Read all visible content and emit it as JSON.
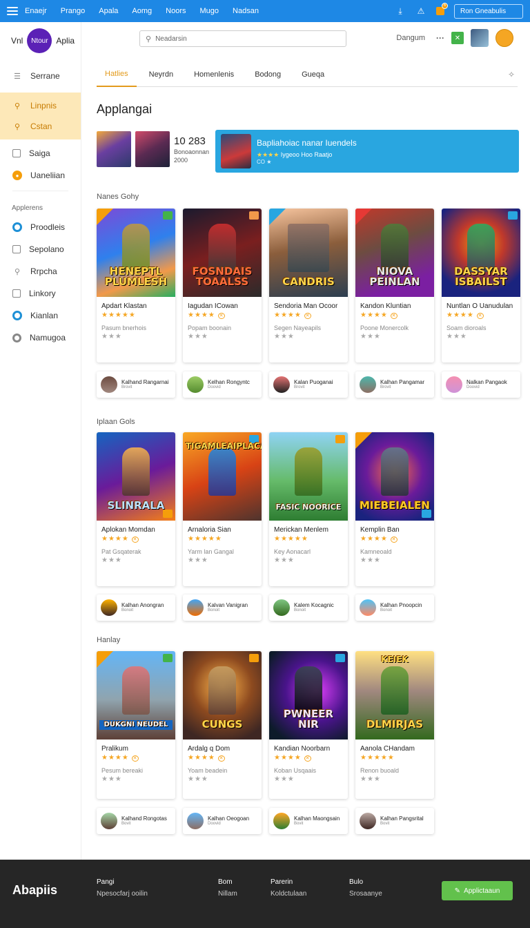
{
  "topbar": {
    "nav": [
      "Enaejr",
      "Prango",
      "Apala",
      "Aomg",
      "Noors",
      "Mugo",
      "Nadsan"
    ],
    "button_label": "Ron Gneabulis",
    "notif_count": "6"
  },
  "sidebar": {
    "brand_left": "Vnl",
    "logo_text": "Ntour",
    "brand_right": "Aplia",
    "menu_label": "Serrane",
    "active_items": [
      "Linpnis",
      "Cstan"
    ],
    "items": [
      "Saiga",
      "Uaneliian"
    ],
    "section_heading": "Applerens",
    "section_items": [
      "Proodleis",
      "Sepolano",
      "Rrpcha",
      "Linkory",
      "Kianlan",
      "Namugoa"
    ]
  },
  "header": {
    "search_placeholder": "Neadarsin",
    "right_label": "Dangum"
  },
  "tabs": [
    "Hatlies",
    "Neyrdn",
    "Homenlenis",
    "Bodong",
    "Gueqa"
  ],
  "page_title": "Applangai",
  "featured": {
    "count": "10 283",
    "sub1": "Bonoaonnan",
    "sub2": "2000",
    "banner_title": "Bapliahoiac nanar Iuendels",
    "banner_stars": "★★★★",
    "banner_sub": "Iygeoo Hoo Raatjo",
    "banner_sub2": "CO ★"
  },
  "sections": [
    {
      "title": "Nanes Gohy",
      "cards": [
        {
          "art": "HENEPTL PLUMLESH",
          "title": "Apdart Klastan",
          "desc": "Pasum bnerhois"
        },
        {
          "art": "FOSNDAIS TOAALSS",
          "title": "Iagudan ICowan",
          "desc": "Popam boonain"
        },
        {
          "art": "CANDRIS",
          "title": "Sendoria Man Ocoor",
          "desc": "Segen Nayeapils"
        },
        {
          "art": "NIOVA PEINLAN",
          "title": "Kandon Kluntian",
          "desc": "Poone Monercolk"
        },
        {
          "art": "DASSYAR ISBAILST",
          "title": "Nuntlan O Uanudulan",
          "desc": "Soam dioroals"
        }
      ],
      "pills": [
        {
          "title": "Kalhand Rangarnai",
          "sub": "Brovit"
        },
        {
          "title": "Kelhan Rongyntc",
          "sub": "Doovid"
        },
        {
          "title": "Kalan Puoganai",
          "sub": "Brovit"
        },
        {
          "title": "Kalhan Pangamar",
          "sub": "Brovit"
        },
        {
          "title": "Nalkan Pangaok",
          "sub": "Doovid"
        }
      ]
    },
    {
      "title": "Iplaan Gols",
      "cards": [
        {
          "art": "SLINRALA",
          "title": "Aplokan Momdan",
          "desc": "Pat Gsqaterak"
        },
        {
          "art": "TIGAMLEAIPLACA",
          "title": "Arnaloria Sian",
          "desc": "Yarm lan Gangal"
        },
        {
          "art": "FASIC NOORICE",
          "title": "Merickan Menlem",
          "desc": "Key Aonacarl"
        },
        {
          "art": "MIEBEIALEN",
          "title": "Kemplin Ban",
          "desc": "Kamneoald"
        }
      ],
      "pills": [
        {
          "title": "Kalhan Anongran",
          "sub": "Bonoit"
        },
        {
          "title": "Kalvan Vanigran",
          "sub": "Bonoit"
        },
        {
          "title": "Kalem Kocagnic",
          "sub": "Bonoit"
        },
        {
          "title": "Kalhan Pnoopcin",
          "sub": "Bonoit"
        }
      ]
    },
    {
      "title": "Hanlay",
      "cards": [
        {
          "art": "DUKGNI NEUDEL",
          "title": "Pralikum",
          "desc": "Pesum bereaki"
        },
        {
          "art": "CUNGS",
          "title": "Ardalg q Dom",
          "desc": "Yoam beadein"
        },
        {
          "art": "PWNEER NIR",
          "title": "Kandian Noorbarn",
          "desc": "Koban Usqaais"
        },
        {
          "art": "DLMIRJAS",
          "title": "Aanola CHandam",
          "desc": "Renon buoald"
        }
      ],
      "pills": [
        {
          "title": "Kalhand Rongotas",
          "sub": "Bovit"
        },
        {
          "title": "Kalhan Oeogoan",
          "sub": "Doovid"
        },
        {
          "title": "Kalhan Maongsain",
          "sub": "Bovit"
        },
        {
          "title": "Kalhan Pangsrital",
          "sub": "Bovit"
        }
      ]
    }
  ],
  "footer": {
    "logo": "Abapiis",
    "col1": [
      "Pangi",
      "Npesocfarj ooilin"
    ],
    "col2": [
      "Bom",
      "Nillam"
    ],
    "col3": [
      "Parerin",
      "Koldctulaan"
    ],
    "col4": [
      "Bulo",
      "Srosaanye"
    ],
    "button": "Applictaaun"
  },
  "colors": {
    "topbar": "#1e88e5",
    "accent": "#e39b1c",
    "banner": "#29a6e0",
    "footer": "#262626",
    "cta": "#62c14c"
  }
}
